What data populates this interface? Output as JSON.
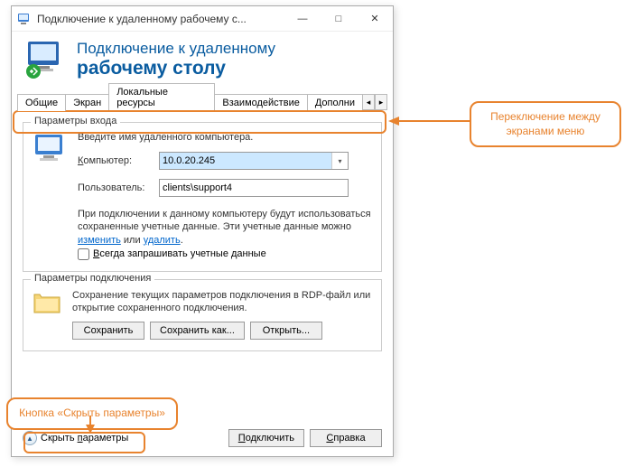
{
  "titlebar": {
    "text": "Подключение к удаленному рабочему с..."
  },
  "header": {
    "line1": "Подключение к удаленному",
    "line2": "рабочему столу"
  },
  "tabs": {
    "t0": "Общие",
    "t1": "Экран",
    "t2": "Локальные ресурсы",
    "t3": "Взаимодействие",
    "t4": "Дополни"
  },
  "login": {
    "group_title": "Параметры входа",
    "intro": "Введите имя удаленного компьютера.",
    "computer_label_pre": "К",
    "computer_label_post": "омпьютер:",
    "computer_value": "10.0.20.245",
    "user_label": "Пользователь:",
    "user_value": "clients\\support4",
    "cred1": "При подключении к данному компьютеру будут использоваться сохраненные учетные данные. Эти учетные данные можно ",
    "cred_link1": "изменить",
    "cred_mid": " или ",
    "cred_link2": "удалить",
    "cred_end": ".",
    "checkbox_pre": "В",
    "checkbox_post": "сегда запрашивать учетные данные"
  },
  "conn": {
    "group_title": "Параметры подключения",
    "text": "Сохранение текущих параметров подключения в RDP-файл или открытие сохраненного подключения.",
    "save": "Сохранить",
    "saveas": "Сохранить как...",
    "open": "Открыть..."
  },
  "bottom": {
    "collapse_pre": "Скрыть ",
    "collapse_ul": "п",
    "collapse_post": "араметры",
    "connect_pre": "П",
    "connect_post": "одключить",
    "help_pre": "С",
    "help_post": "правка"
  },
  "callouts": {
    "c1": "Переключение между экранами меню",
    "c2": "Кнопка «Скрыть параметры»"
  }
}
